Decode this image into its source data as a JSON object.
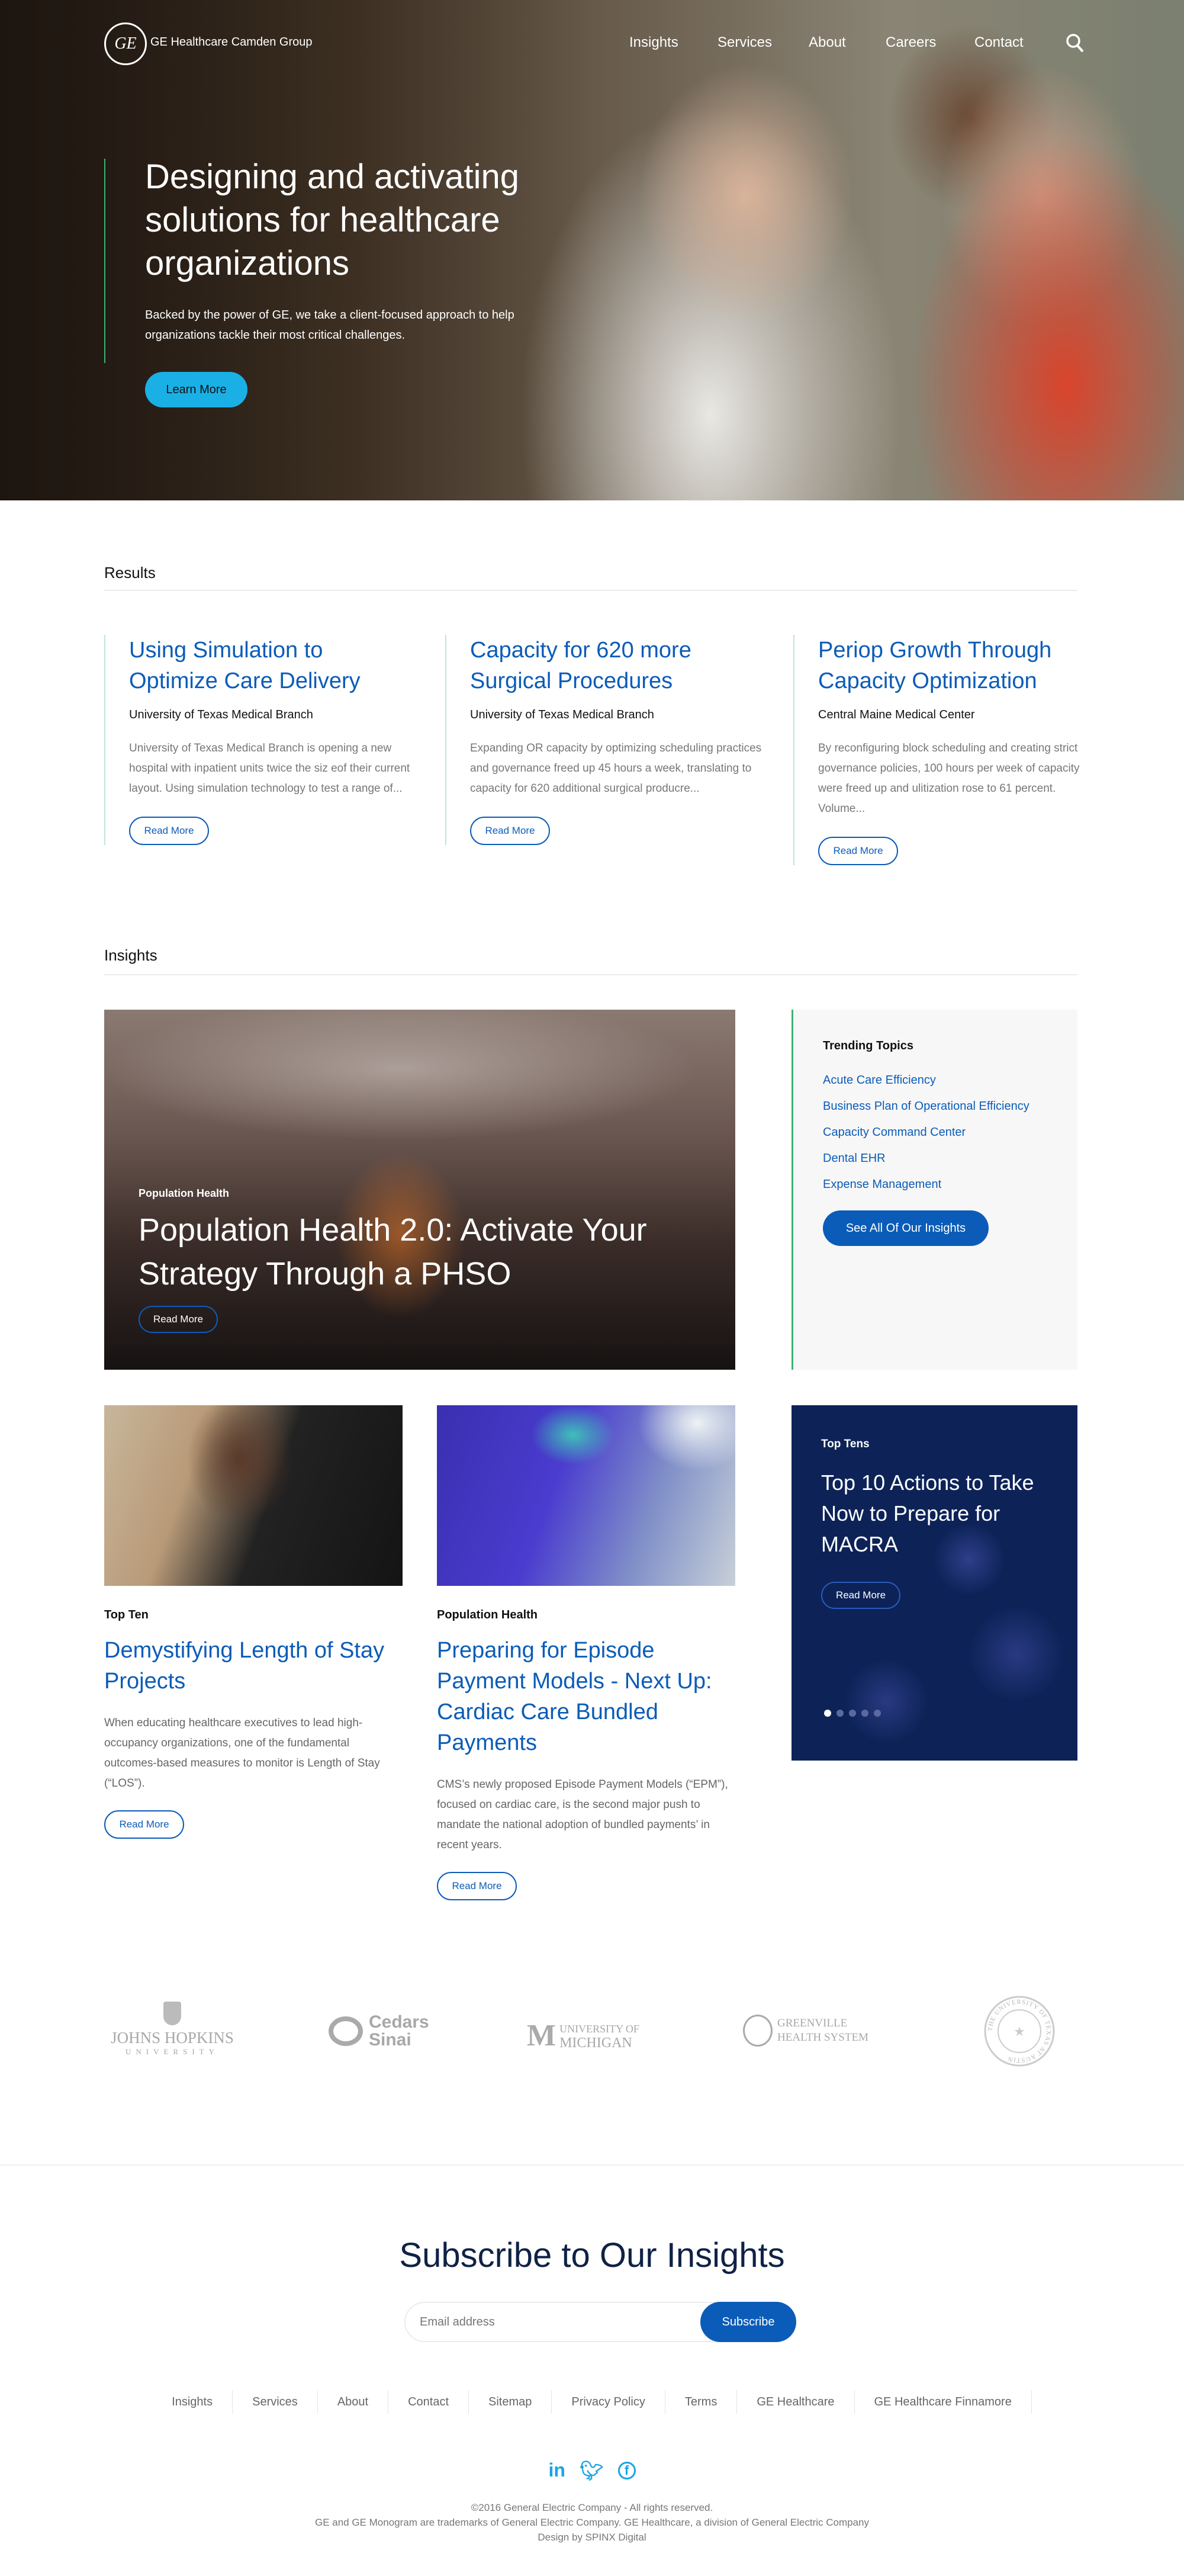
{
  "header": {
    "brand": "GE Healthcare Camden Group",
    "logo_text": "GE",
    "nav": [
      "Insights",
      "Services",
      "About",
      "Careers",
      "Contact"
    ],
    "search_icon": "search-icon"
  },
  "hero": {
    "title": "Designing and activating solutions for healthcare organizations",
    "body": "Backed by the power of GE, we take a client-focused approach to help organizations tackle their most critical challenges.",
    "cta": "Learn More",
    "cta_color": "#1ab0e6"
  },
  "results": {
    "heading": "Results",
    "items": [
      {
        "title": "Using Simulation to Optimize Care Delivery",
        "client": "University of Texas Medical Branch",
        "desc": "University of Texas Medical Branch is opening a new hospital with inpatient units twice the siz eof their current layout. Using simulation technology to test a range of...",
        "cta": "Read More"
      },
      {
        "title": "Capacity for 620 more Surgical Procedures",
        "client": "University of Texas Medical Branch",
        "desc": "Expanding OR capacity by optimizing scheduling practices and governance freed up 45 hours a week, translating to capacity for 620 additional surgical producre...",
        "cta": "Read More"
      },
      {
        "title": "Periop Growth Through Capacity Optimization",
        "client": "Central Maine Medical Center",
        "desc": "By reconfiguring block scheduling and creating strict governance policies, 100 hours per week of capacity were freed up and ulitization rose to 61 percent. Volume...",
        "cta": "Read More"
      }
    ]
  },
  "insights": {
    "heading": "Insights",
    "featured": {
      "category": "Population Health",
      "title": "Population Health 2.0: Activate Your Strategy Through a PHSO",
      "cta": "Read More"
    },
    "trending": {
      "heading": "Trending Topics",
      "topics": [
        "Acute Care Efficiency",
        "Business Plan of Operational Efficiency",
        "Capacity Command Center",
        "Dental EHR",
        "Expense Management"
      ],
      "cta": "See All Of Our Insights"
    },
    "cards": [
      {
        "category": "Top Ten",
        "title": "Demystifying Length of Stay Projects",
        "desc": "When educating healthcare executives to lead high-occupancy organizations, one of the fundamental outcomes-based measures to monitor is Length of Stay (“LOS”).",
        "cta": "Read More"
      },
      {
        "category": "Population Health",
        "title": "Preparing for Episode Payment Models - Next Up: Cardiac Care Bundled Payments",
        "desc": "CMS’s newly proposed Episode Payment Models (“EPM”), focused on cardiac care, is the second major push to mandate the national adoption of bundled payments’ in recent years.",
        "cta": "Read More"
      }
    ],
    "carousel": {
      "category": "Top Tens",
      "title": "Top 10 Actions to Take Now to Prepare for MACRA",
      "cta": "Read More",
      "slides": 5,
      "active_slide": 1
    }
  },
  "clients": [
    "JOHNS HOPKINS",
    "UNIVERSITY",
    "Cedars",
    "Sinai",
    "UNIVERSITY OF",
    "MICHIGAN",
    "GREENVILLE",
    "HEALTH SYSTEM",
    "THE UNIVERSITY OF TEXAS AT AUSTIN"
  ],
  "subscribe": {
    "heading": "Subscribe to Our Insights",
    "placeholder": "Email address",
    "button": "Subscribe"
  },
  "footer": {
    "links": [
      "Insights",
      "Services",
      "About",
      "Contact",
      "Sitemap",
      "Privacy Policy",
      "Terms",
      "GE Healthcare",
      "GE Healthcare Finnamore"
    ],
    "social": [
      "in",
      "t",
      "f"
    ],
    "copyright": "©2016 General Electric Company - All rights reserved.",
    "trademark": "GE and GE Monogram are trademarks of General Electric Company. GE Healthcare, a division of General Electric Company",
    "credit": "Design by SPINX Digital"
  },
  "colors": {
    "primary": "#0b5cb8",
    "accent": "#1ab0e6",
    "green": "#3cb371",
    "navy": "#0d2358"
  }
}
